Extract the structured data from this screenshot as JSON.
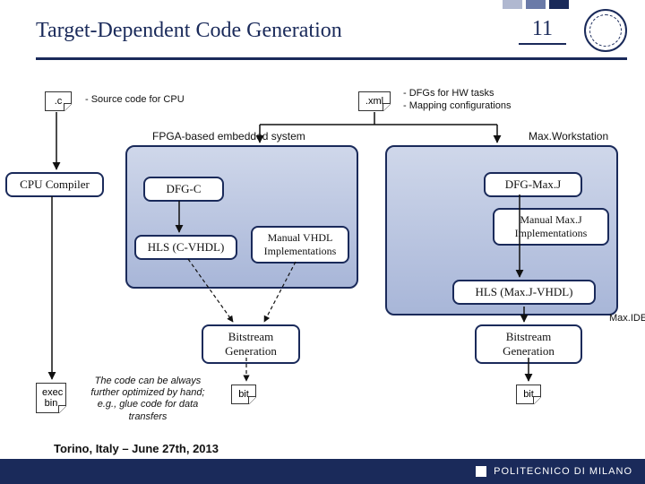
{
  "header": {
    "title": "Target-Dependent Code Generation",
    "page_number": "11"
  },
  "files": {
    "c": ".c",
    "xml": ".xml",
    "exec": "exec\nbin",
    "bit_left": "bit",
    "bit_right": "bit"
  },
  "notes": {
    "c_note": "-  Source code for CPU",
    "xml_note1": "-  DFGs for HW tasks",
    "xml_note2": "-  Mapping configurations",
    "fpga_label": "FPGA-based embedded system",
    "maxws": "Max.Workstation",
    "maxide": "Max.IDE",
    "opt": "The code can be always further optimized by hand; e.g., glue code for data transfers"
  },
  "boxes": {
    "cpu_compiler": "CPU Compiler",
    "dfg_c": "DFG-C",
    "hls_cvhdl": "HLS (C-VHDL)",
    "manual_vhdl": "Manual VHDL Implementations",
    "dfg_maxj": "DFG-Max.J",
    "manual_maxj": "Manual Max.J Implementations",
    "hls_maxj": "HLS (Max.J-VHDL)",
    "bitgen_left": "Bitstream Generation",
    "bitgen_right": "Bitstream Generation"
  },
  "footer": {
    "venue": "Torino, Italy – June 27th, 2013",
    "brand": "POLITECNICO DI MILANO"
  }
}
